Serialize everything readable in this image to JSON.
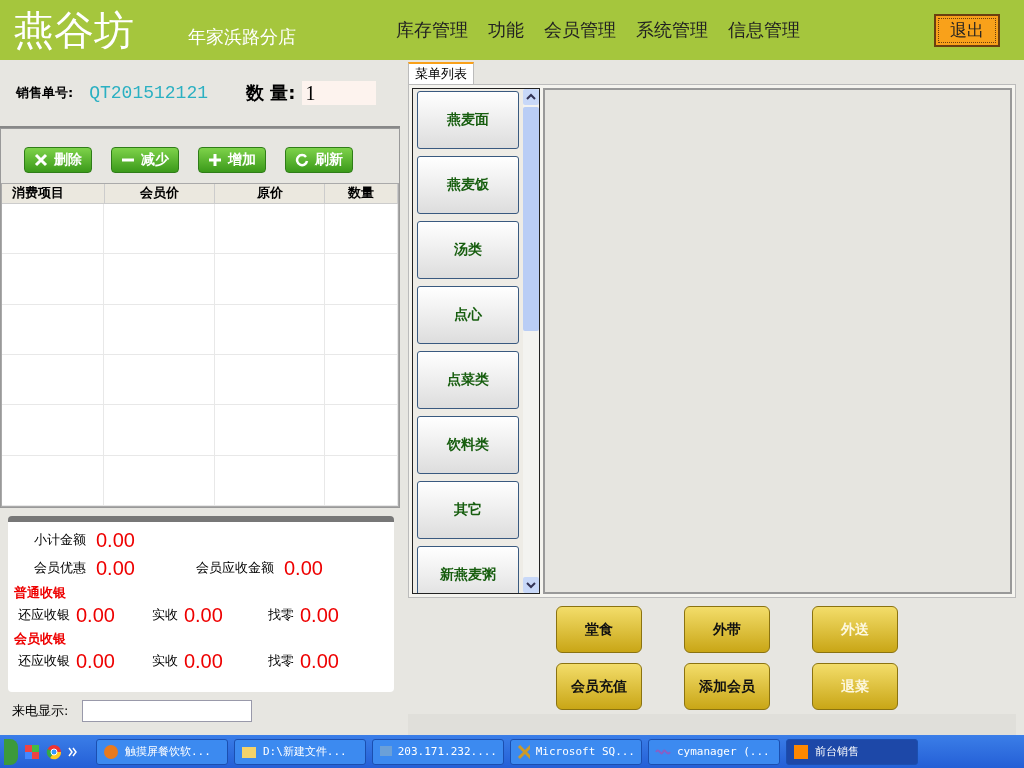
{
  "header": {
    "logo": "燕谷坊",
    "branch": "年家浜路分店",
    "menu": [
      {
        "label": "库存管理"
      },
      {
        "label": "功能"
      },
      {
        "label": "会员管理"
      },
      {
        "label": "系统管理"
      },
      {
        "label": "信息管理"
      }
    ],
    "exit": "退出"
  },
  "order": {
    "number_label": "销售单号:",
    "number": "QT201512121",
    "quantity_label": "数 量:",
    "quantity": "1"
  },
  "toolbar": [
    {
      "kind": "delete",
      "label": "删除"
    },
    {
      "kind": "minus",
      "label": "减少"
    },
    {
      "kind": "plus",
      "label": "增加"
    },
    {
      "kind": "refresh",
      "label": "刷新"
    }
  ],
  "table": {
    "columns": [
      "消费项目",
      "会员价",
      "原价",
      "数量"
    ]
  },
  "receipt": {
    "top": [
      {
        "label": "小计金额",
        "value": "0.00"
      },
      {
        "label": "会员优惠",
        "value": "0.00"
      },
      {
        "label": "会员应收金额",
        "value": "0.00"
      }
    ],
    "sections": [
      {
        "title": "普通收银",
        "items": [
          {
            "label": "还应收银",
            "value": "0.00"
          },
          {
            "label": "实收",
            "value": "0.00"
          },
          {
            "label": "找零",
            "value": "0.00"
          }
        ]
      },
      {
        "title": "会员收银",
        "items": [
          {
            "label": "还应收银",
            "value": "0.00"
          },
          {
            "label": "实收",
            "value": "0.00"
          },
          {
            "label": "找零",
            "value": "0.00"
          }
        ]
      }
    ]
  },
  "caller": {
    "label": "来电显示:"
  },
  "menu_tab": {
    "label": "菜单列表",
    "selected": true
  },
  "categories": [
    "燕麦面",
    "燕麦饭",
    "汤类",
    "点心",
    "点菜类",
    "饮料类",
    "其它",
    "新燕麦粥"
  ],
  "actions": [
    {
      "label": "堂食",
      "disabled": false
    },
    {
      "label": "外带",
      "disabled": false
    },
    {
      "label": "外送",
      "disabled": true
    },
    {
      "label": "会员充值",
      "disabled": false
    },
    {
      "label": "添加会员",
      "disabled": false
    },
    {
      "label": "退菜",
      "disabled": true
    }
  ],
  "taskbar": [
    {
      "kind": "browser",
      "label": "触摸屏餐饮软..."
    },
    {
      "kind": "folder",
      "label": "D:\\新建文件..."
    },
    {
      "kind": "remote",
      "label": "203.171.232...."
    },
    {
      "kind": "sql",
      "label": "Microsoft SQ..."
    },
    {
      "kind": "vs",
      "label": "cymanager (..."
    },
    {
      "kind": "app",
      "label": "前台销售"
    }
  ]
}
